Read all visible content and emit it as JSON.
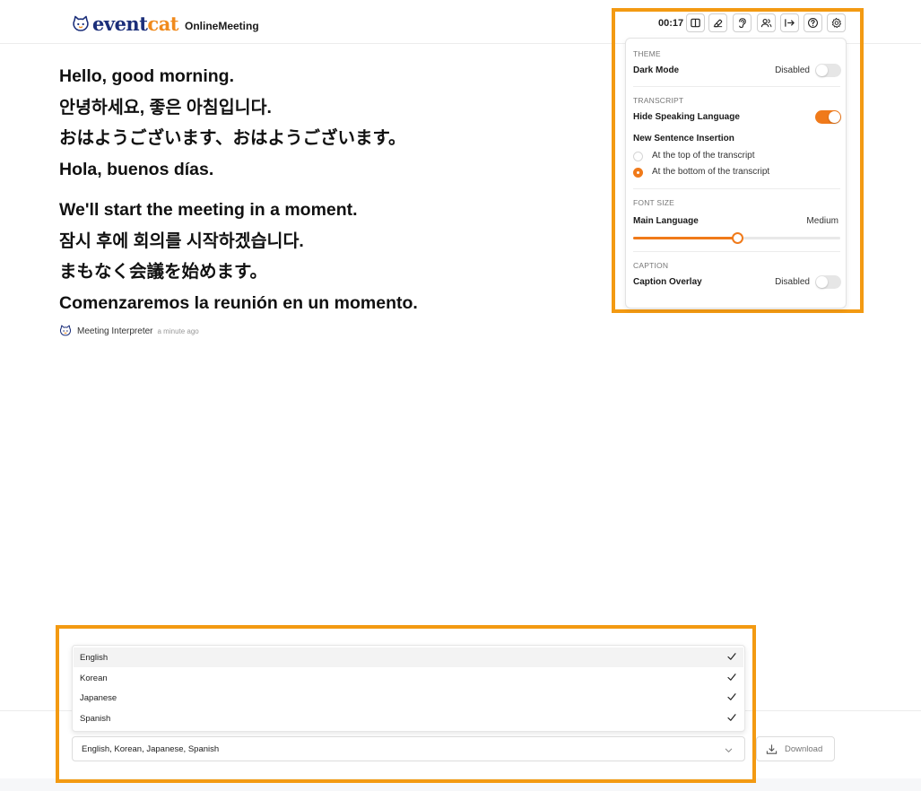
{
  "header": {
    "logo": {
      "part1": "event",
      "part2": "cat"
    },
    "app_name": "OnlineMeeting",
    "timer": "00:17",
    "toolbar_icons": [
      "split-view-icon",
      "eraser-icon",
      "ear-icon",
      "participants-icon",
      "exit-arrow-icon",
      "help-icon",
      "gear-icon"
    ]
  },
  "transcript": {
    "block1": [
      "Hello, good morning.",
      "안녕하세요, 좋은 아침입니다.",
      "おはようございます、おはようございます。",
      "Hola, buenos días."
    ],
    "block2": [
      "We'll start the meeting in a moment.",
      "잠시 후에 회의를 시작하겠습니다.",
      "まもなく会議を始めます。",
      "Comenzaremos la reunión en un momento."
    ],
    "speaker": "Meeting Interpreter",
    "time_ago": "a minute ago"
  },
  "settings": {
    "theme": {
      "section": "THEME",
      "dark_mode_label": "Dark Mode",
      "dark_mode_value": "Disabled",
      "dark_mode_on": false
    },
    "transcript": {
      "section": "TRANSCRIPT",
      "hide_speaking_label": "Hide Speaking Language",
      "hide_speaking_on": true,
      "insertion_label": "New Sentence Insertion",
      "insertion_options": [
        "At the top of the transcript",
        "At the bottom of the transcript"
      ],
      "insertion_selected": 1
    },
    "font_size": {
      "section": "FONT SIZE",
      "main_language_label": "Main Language",
      "main_language_value": "Medium",
      "slider_fraction": 0.5
    },
    "caption": {
      "section": "CAPTION",
      "overlay_label": "Caption Overlay",
      "overlay_value": "Disabled",
      "overlay_on": false
    }
  },
  "language_select": {
    "options": [
      {
        "label": "English",
        "checked": true
      },
      {
        "label": "Korean",
        "checked": true
      },
      {
        "label": "Japanese",
        "checked": true
      },
      {
        "label": "Spanish",
        "checked": true
      }
    ],
    "highlighted_index": 0,
    "value": "English, Korean, Japanese, Spanish"
  },
  "download": {
    "label": "Download"
  },
  "colors": {
    "accent": "#f07a1a",
    "highlight_outline": "#f39a12",
    "logo_dark": "#1c2f7a",
    "logo_orange": "#f08a1c"
  }
}
